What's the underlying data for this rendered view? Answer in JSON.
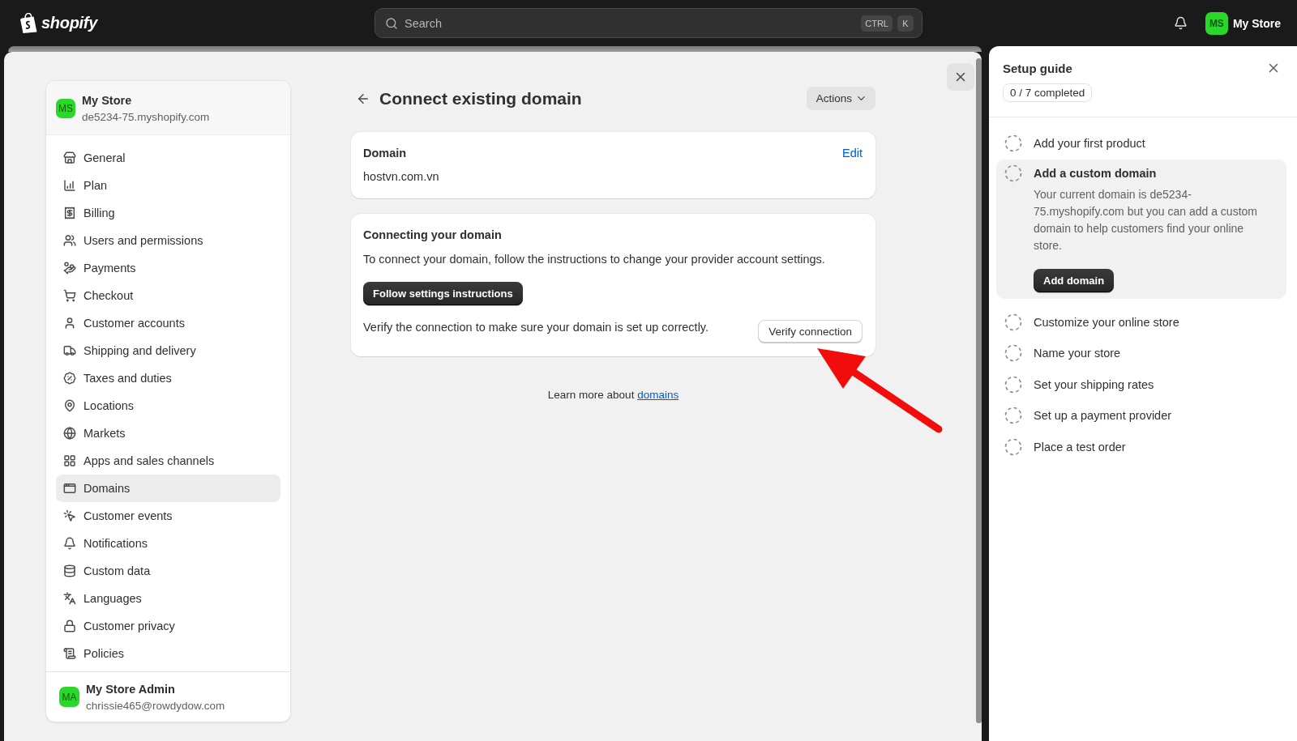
{
  "topbar": {
    "logo": "shopify",
    "search": {
      "placeholder": "Search",
      "shortcut": [
        "CTRL",
        "K"
      ]
    },
    "account": {
      "initials": "MS",
      "name": "My Store"
    }
  },
  "settings": {
    "store": {
      "initials": "MS",
      "name": "My Store",
      "domain": "de5234-75.myshopify.com"
    },
    "nav": [
      {
        "label": "General",
        "selected": false
      },
      {
        "label": "Plan",
        "selected": false
      },
      {
        "label": "Billing",
        "selected": false
      },
      {
        "label": "Users and permissions",
        "selected": false
      },
      {
        "label": "Payments",
        "selected": false
      },
      {
        "label": "Checkout",
        "selected": false
      },
      {
        "label": "Customer accounts",
        "selected": false
      },
      {
        "label": "Shipping and delivery",
        "selected": false
      },
      {
        "label": "Taxes and duties",
        "selected": false
      },
      {
        "label": "Locations",
        "selected": false
      },
      {
        "label": "Markets",
        "selected": false
      },
      {
        "label": "Apps and sales channels",
        "selected": false
      },
      {
        "label": "Domains",
        "selected": true
      },
      {
        "label": "Customer events",
        "selected": false
      },
      {
        "label": "Notifications",
        "selected": false
      },
      {
        "label": "Custom data",
        "selected": false
      },
      {
        "label": "Languages",
        "selected": false
      },
      {
        "label": "Customer privacy",
        "selected": false
      },
      {
        "label": "Policies",
        "selected": false
      }
    ],
    "user": {
      "initials": "MA",
      "name": "My Store Admin",
      "email": "chrissie465@rowdydow.com"
    }
  },
  "page": {
    "title": "Connect existing domain",
    "actions": "Actions",
    "domain_card": {
      "title": "Domain",
      "edit": "Edit",
      "value": "hostvn.com.vn"
    },
    "connect_card": {
      "title": "Connecting your domain",
      "description": "To connect your domain, follow the instructions to change your provider account settings.",
      "primary_button": "Follow settings instructions",
      "verify_text": "Verify the connection to make sure your domain is set up correctly.",
      "verify_button": "Verify connection"
    },
    "footer": {
      "text": "Learn more about",
      "link": "domains"
    }
  },
  "setup_guide": {
    "title": "Setup guide",
    "progress": "0 / 7 completed",
    "tasks": [
      {
        "label": "Add your first product",
        "completed": false,
        "expanded": false
      },
      {
        "label": "Add a custom domain",
        "completed": false,
        "expanded": true,
        "description": "Your current domain is de5234-75.myshopify.com but you can add a custom domain to help customers find your online store.",
        "button": "Add domain"
      },
      {
        "label": "Customize your online store",
        "completed": false,
        "expanded": false
      },
      {
        "label": "Name your store",
        "completed": false,
        "expanded": false
      },
      {
        "label": "Set your shipping rates",
        "completed": false,
        "expanded": false
      },
      {
        "label": "Set up a payment provider",
        "completed": false,
        "expanded": false
      },
      {
        "label": "Place a test order",
        "completed": false,
        "expanded": false
      }
    ]
  }
}
